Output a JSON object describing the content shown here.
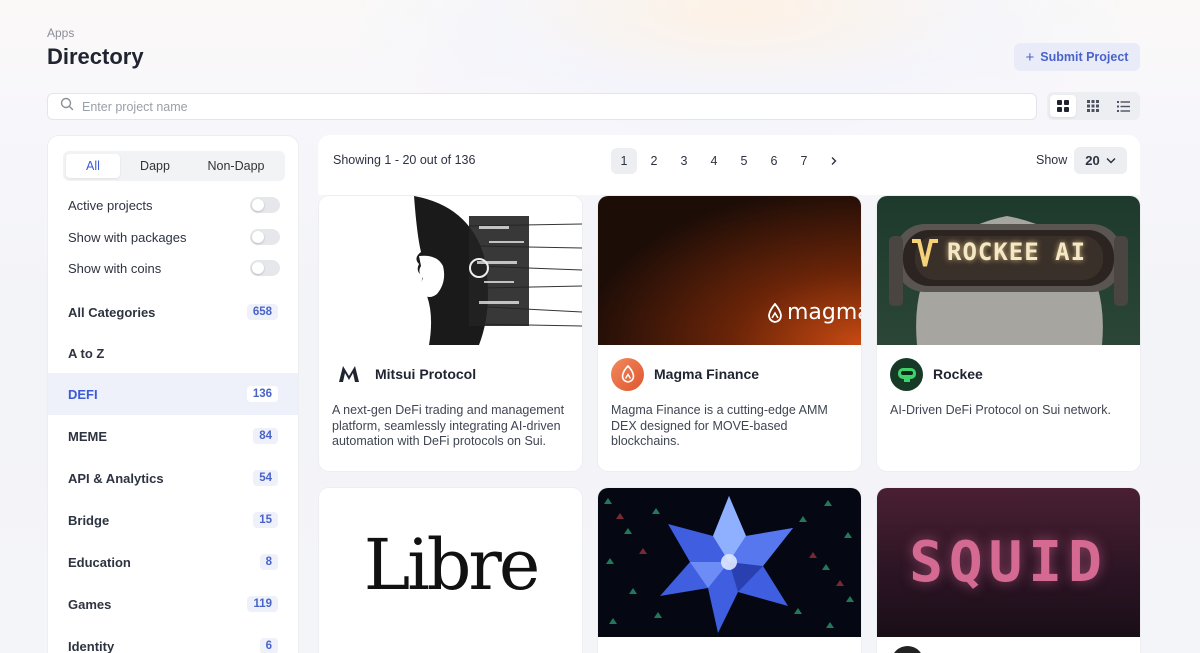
{
  "header": {
    "breadcrumb": "Apps",
    "title": "Directory",
    "submit_label": "Submit Project"
  },
  "search": {
    "placeholder": "Enter project name",
    "value": ""
  },
  "view_modes": {
    "options": [
      "grid-large",
      "grid-small",
      "list"
    ],
    "active": "grid-large"
  },
  "filters": {
    "segments": [
      "All",
      "Dapp",
      "Non-Dapp"
    ],
    "active_segment": "All",
    "toggles": [
      {
        "label": "Active projects",
        "on": false
      },
      {
        "label": "Show with packages",
        "on": false
      },
      {
        "label": "Show with coins",
        "on": false
      }
    ]
  },
  "categories": [
    {
      "label": "All Categories",
      "count": "658"
    },
    {
      "label": "A to Z",
      "count": ""
    },
    {
      "label": "DEFI",
      "count": "136",
      "active": true
    },
    {
      "label": "MEME",
      "count": "84"
    },
    {
      "label": "API & Analytics",
      "count": "54"
    },
    {
      "label": "Bridge",
      "count": "15"
    },
    {
      "label": "Education",
      "count": "8"
    },
    {
      "label": "Games",
      "count": "119"
    },
    {
      "label": "Identity",
      "count": "6"
    }
  ],
  "results": {
    "showing": "Showing 1 - 20 out of 136",
    "pages": [
      "1",
      "2",
      "3",
      "4",
      "5",
      "6",
      "7"
    ],
    "active_page": "1",
    "next_icon": "chevron-right-icon",
    "show_label": "Show",
    "page_size": "20"
  },
  "projects": [
    {
      "name": "Mitsui Protocol",
      "description": "A next-gen DeFi trading and management platform, seamlessly integrating AI-driven automation with DeFi protocols on Sui.",
      "logo_icon": "mitsui-logo-icon"
    },
    {
      "name": "Magma Finance",
      "description": "Magma Finance is a cutting-edge AMM DEX designed for MOVE-based blockchains.",
      "logo_icon": "magma-logo-icon",
      "banner_text": "magma"
    },
    {
      "name": "Rockee",
      "description": "AI-Driven DeFi Protocol on Sui network.",
      "logo_icon": "rockee-logo-icon",
      "banner_text": "ROCKEE AI"
    },
    {
      "banner_text": "Libre"
    },
    {
      "banner_text": ""
    },
    {
      "banner_text": "SQUID"
    }
  ],
  "colors": {
    "accent": "#4a63c9",
    "active_bg": "#eef1fa"
  }
}
